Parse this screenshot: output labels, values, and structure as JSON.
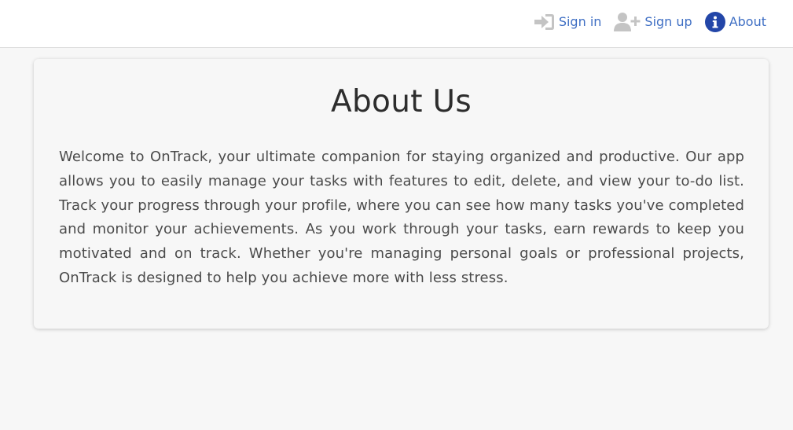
{
  "nav": {
    "items": [
      {
        "label": "Sign in",
        "icon": "sign-in-icon"
      },
      {
        "label": "Sign up",
        "icon": "user-plus-icon"
      },
      {
        "label": "About",
        "icon": "info-circle-icon"
      }
    ]
  },
  "about": {
    "title": "About Us",
    "body": "Welcome to OnTrack, your ultimate companion for staying organized and productive. Our app allows you to easily manage your tasks with features to edit, delete, and view your to-do list. Track your progress through your profile, where you can see how many tasks you've completed and monitor your achievements. As you work through your tasks, earn rewards to keep you motivated and on track. Whether you're managing personal goals or professional projects, OnTrack is designed to help you achieve more with less stress."
  },
  "colors": {
    "link": "#3f6fc4",
    "icon_gray": "#c4c4c4",
    "info_icon": "#2346a8",
    "page_bg": "#f7f7f7",
    "heading": "#2d2d2d",
    "body_text": "#4b4b4b"
  }
}
